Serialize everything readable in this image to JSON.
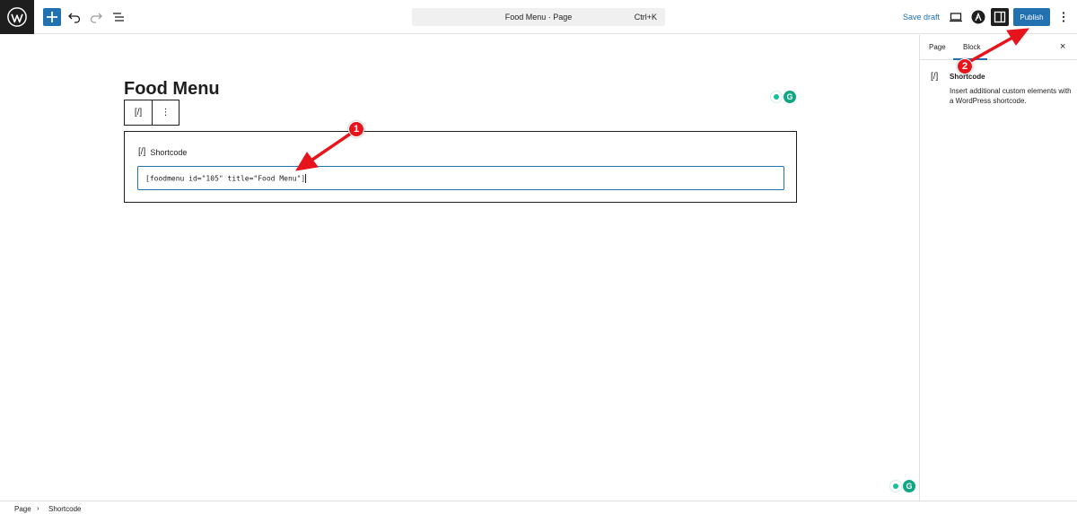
{
  "header": {
    "command_bar_title": "Food Menu · Page",
    "command_bar_shortcut": "Ctrl+K",
    "save_draft_label": "Save draft",
    "publish_label": "Publish",
    "icons": [
      "wordpress-logo",
      "plus-icon",
      "undo-icon",
      "redo-icon",
      "list-view-icon",
      "preview-icon",
      "astra-icon",
      "settings-sidebar-icon",
      "more-options-icon"
    ]
  },
  "editor": {
    "page_title": "Food Menu",
    "block_toolbar": {
      "block_icon": "[/]",
      "options_icon": "⋮"
    },
    "shortcode_block": {
      "icon": "[/]",
      "label": "Shortcode",
      "value": "[foodmenu id=\"105\" title=\"Food Menu\"]"
    },
    "grammarly_letter": "G"
  },
  "sidebar": {
    "tabs": [
      "Page",
      "Block"
    ],
    "active_tab": "Block",
    "close_icon": "×",
    "block_icon": "[/]",
    "block_title": "Shortcode",
    "block_description": "Insert additional custom elements with a WordPress shortcode."
  },
  "footer": {
    "breadcrumb_root": "Page",
    "breadcrumb_separator": "›",
    "breadcrumb_current": "Shortcode"
  },
  "annotations": {
    "badge_1": "1",
    "badge_2": "2",
    "color": "#e8141c"
  },
  "colors": {
    "accent": "#2271b1",
    "dark": "#1e1e1e",
    "grammarly": "#11a683"
  }
}
